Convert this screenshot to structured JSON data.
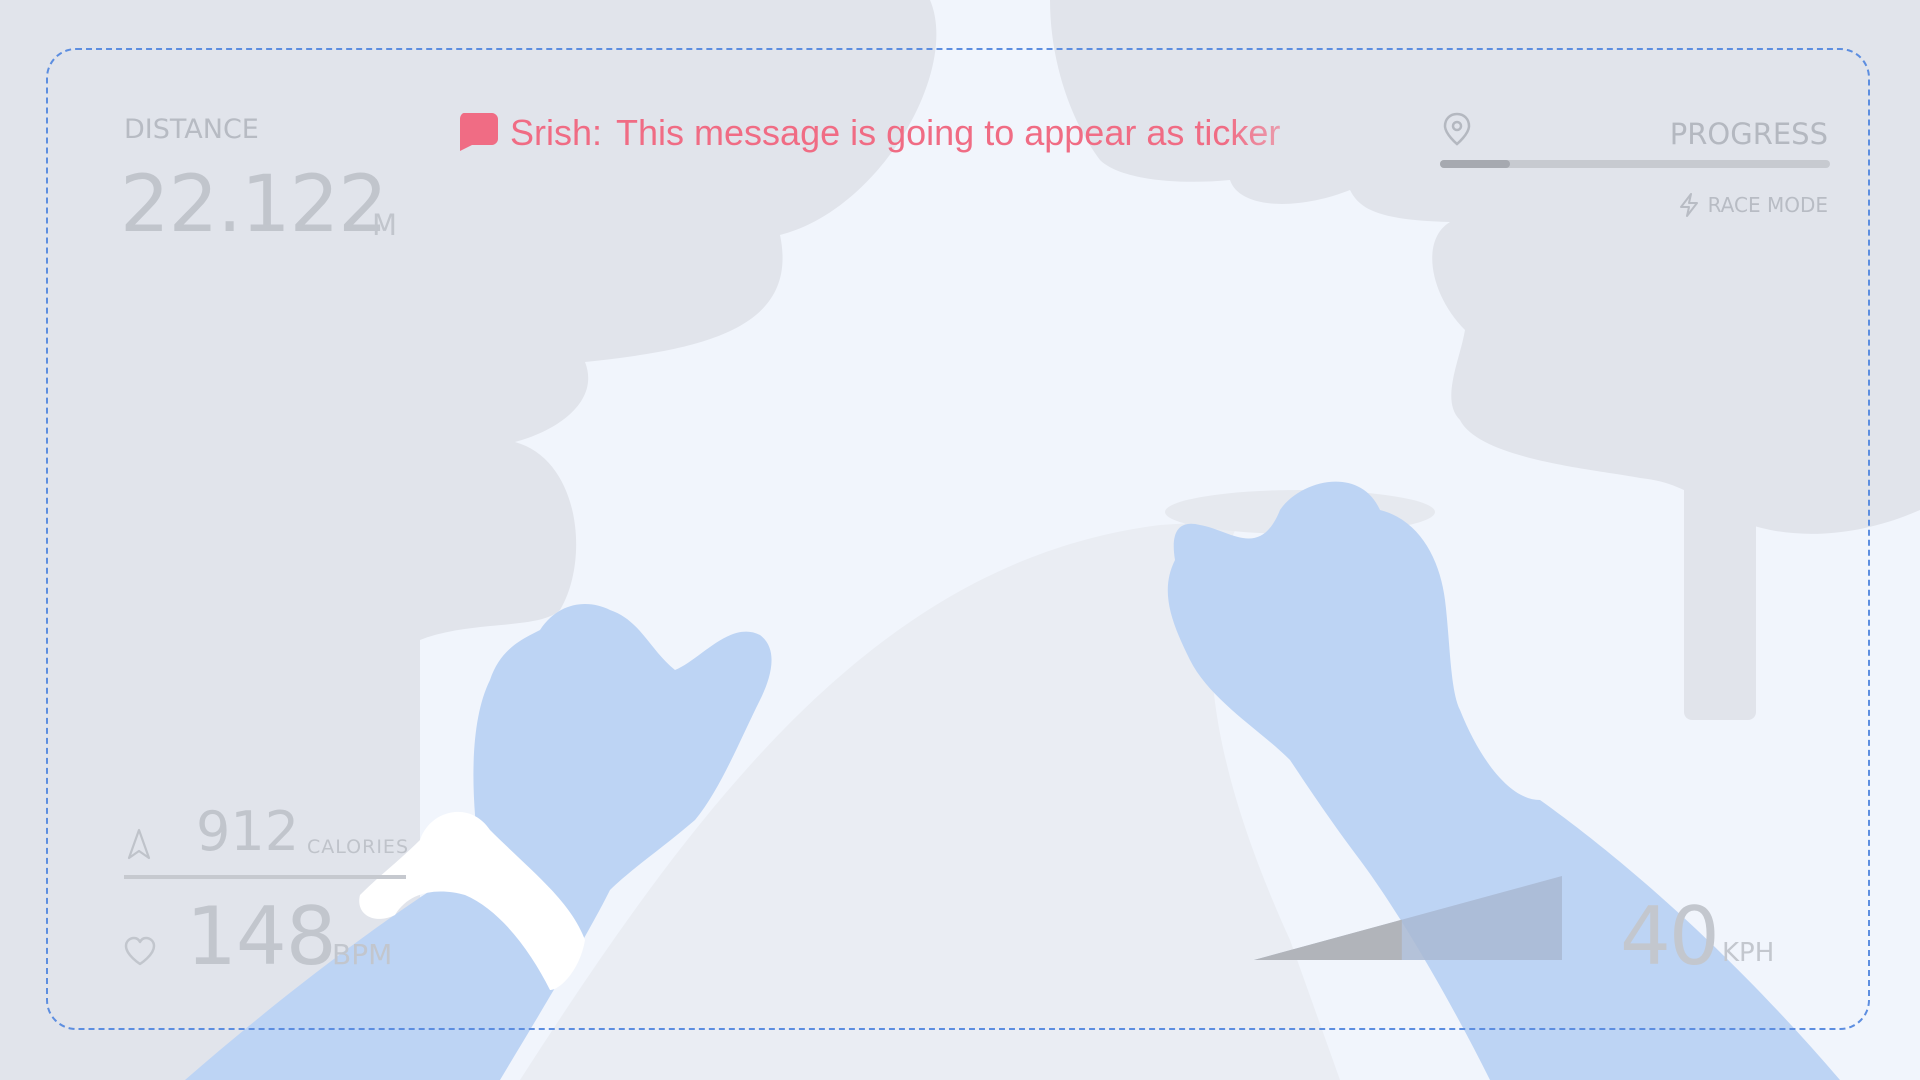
{
  "hud": {
    "distance": {
      "label": "DISTANCE",
      "value": "22.122",
      "unit": "M"
    },
    "ticker": {
      "sender": "Srish:",
      "message": "This message is going to appear as ticker",
      "icon": "chat-bubble-icon",
      "color": "#f06c84"
    },
    "progress": {
      "label": "PROGRESS",
      "fraction": 0.18,
      "icon": "map-pin-icon"
    },
    "race_mode": {
      "label": "RACE MODE",
      "icon": "lightning-icon"
    },
    "calories": {
      "value": "912",
      "unit": "CALORIES",
      "icon": "navigation-arrow-icon"
    },
    "heart_rate": {
      "value": "148",
      "unit": "BPM",
      "icon": "heart-icon"
    },
    "speed": {
      "value": "40",
      "unit": "KPH",
      "gauge_fraction": 0.48
    }
  },
  "colors": {
    "frame": "#5d8ee0",
    "hands": "#bdd4f4",
    "clouds": "#e1e4eb",
    "text_muted": "#c1c5cc"
  }
}
